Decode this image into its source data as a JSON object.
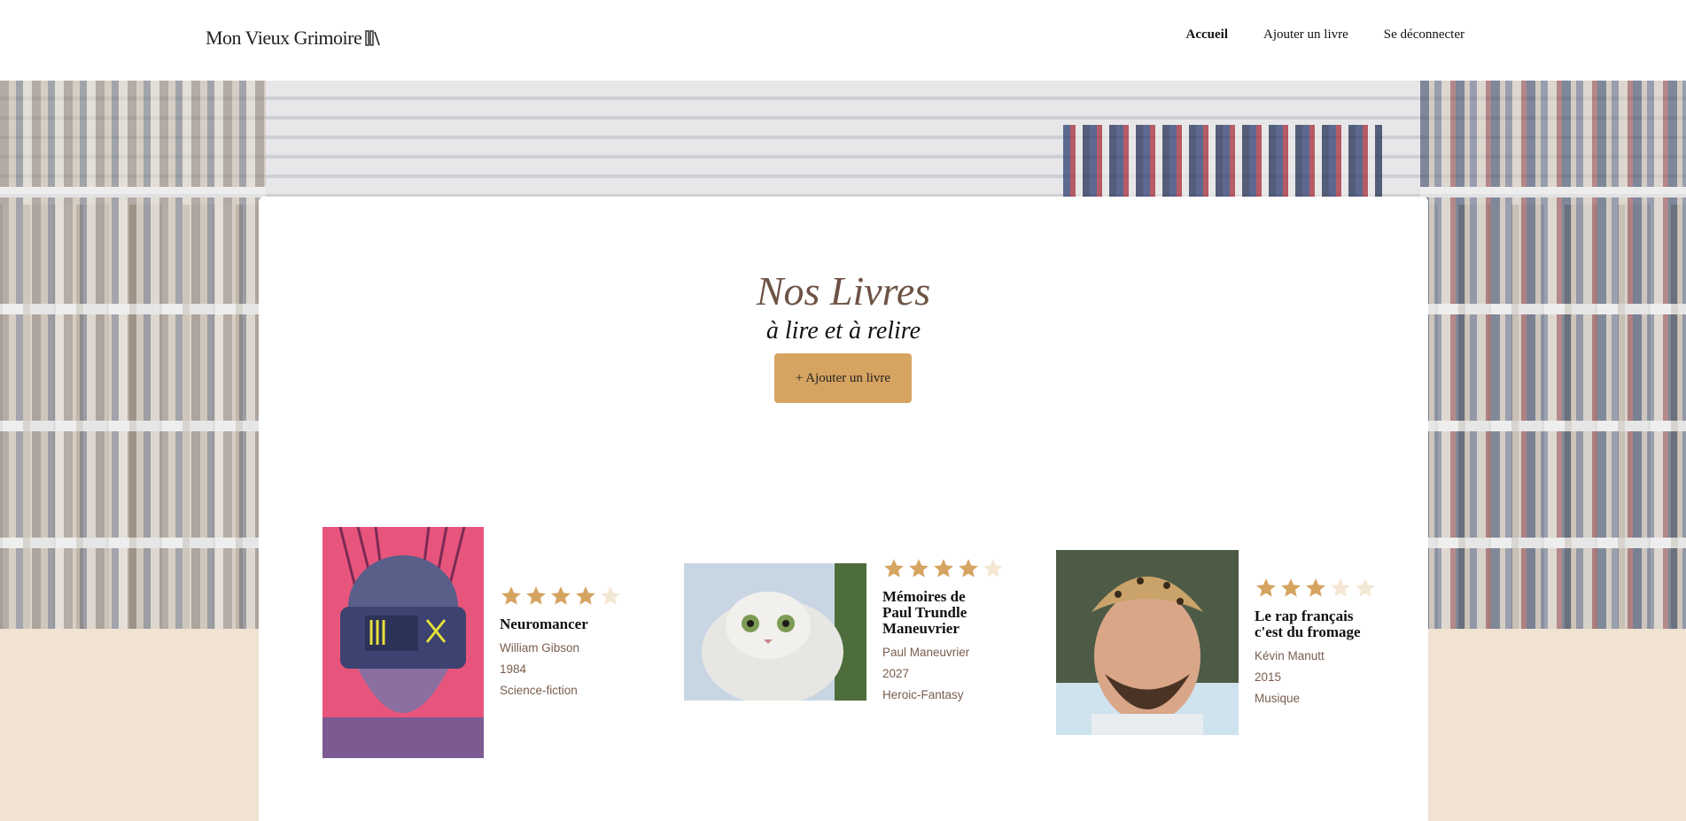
{
  "header": {
    "logo_text": "Mon Vieux Grimoire",
    "nav": [
      {
        "label": "Accueil",
        "active": true
      },
      {
        "label": "Ajouter un livre",
        "active": false
      },
      {
        "label": "Se déconnecter",
        "active": false
      }
    ]
  },
  "main": {
    "title": "Nos Livres",
    "subtitle": "à lire et à relire",
    "add_button_label": "+ Ajouter un livre"
  },
  "books": [
    {
      "title": "Neuromancer",
      "author": "William Gibson",
      "year": "1984",
      "genre": "Science-fiction",
      "rating": 4
    },
    {
      "title": "Mémoires de Paul Trundle Maneuvrier",
      "author": "Paul Maneuvrier",
      "year": "2027",
      "genre": "Heroic-Fantasy",
      "rating": 4
    },
    {
      "title": "Le rap français c'est du fromage",
      "author": "Kévin Manutt",
      "year": "2015",
      "genre": "Musique",
      "rating": 3
    }
  ],
  "colors": {
    "accent": "#d6a461",
    "star_filled": "#d6a461",
    "star_empty": "#f3e7d4",
    "title_color": "#6e5345",
    "footer_bg": "#f0e3d1"
  }
}
